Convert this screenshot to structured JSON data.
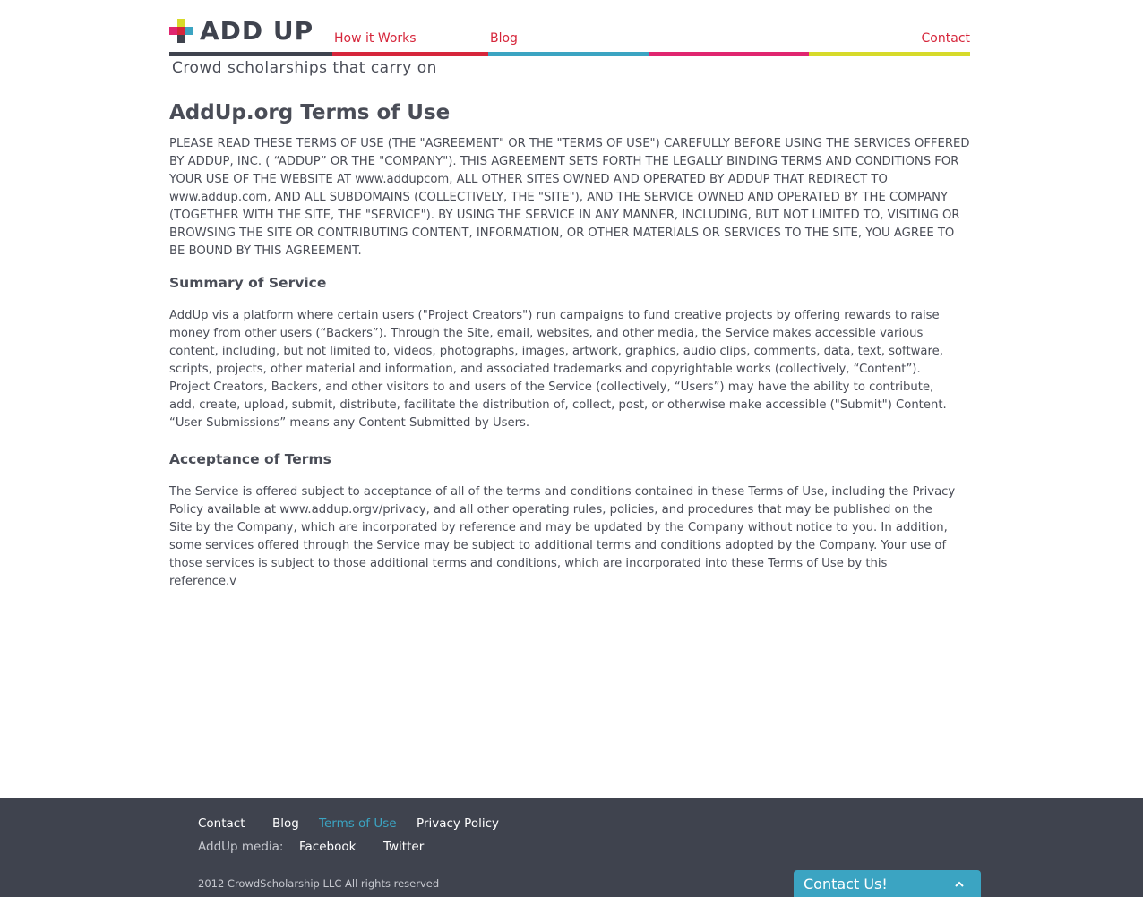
{
  "brand": {
    "logo_text": "ADD UP",
    "tagline": "Crowd scholarships that carry on",
    "colors": {
      "dark": "#3f434e",
      "red": "#d6263b",
      "blue": "#3ba4c2",
      "pink": "#e0266f",
      "yellow": "#d7da2a"
    }
  },
  "nav": {
    "how_it_works": "How it Works",
    "blog": "Blog",
    "contact": "Contact"
  },
  "page": {
    "title": "AddUp.org Terms of Use",
    "intro": "PLEASE READ THESE TERMS OF USE (THE \"AGREEMENT\" OR THE \"TERMS OF USE\") CAREFULLY BEFORE USING THE SERVICES OFFERED BY ADDUP, INC. ( “ADDUP” OR THE \"COMPANY\"). THIS AGREEMENT SETS FORTH THE LEGALLY BINDING TERMS AND CONDITIONS FOR YOUR USE OF THE WEBSITE AT www.addupcom, ALL OTHER SITES OWNED AND OPERATED BY ADDUP THAT REDIRECT TO www.addup.com, AND ALL SUBDOMAINS (COLLECTIVELY, THE \"SITE\"), AND THE SERVICE OWNED AND OPERATED BY THE COMPANY (TOGETHER WITH THE SITE, THE \"SERVICE\"). BY USING THE SERVICE IN ANY MANNER, INCLUDING, BUT NOT LIMITED TO, VISITING OR BROWSING THE SITE OR CONTRIBUTING CONTENT, INFORMATION, OR OTHER MATERIALS OR SERVICES TO THE SITE, YOU AGREE TO BE BOUND BY THIS AGREEMENT.",
    "sections": [
      {
        "title": "Summary of Service",
        "body": "AddUp vis a platform where certain users (\"Project Creators\") run campaigns to fund creative projects by offering rewards to raise money from other users (“Backers”). Through the Site, email, websites, and other media, the Service makes accessible various content, including, but not limited to, videos, photographs, images, artwork, graphics, audio clips, comments, data, text, software, scripts, projects, other material and information, and associated trademarks and copyrightable works (collectively, “Content”). Project Creators, Backers, and other visitors to and users of the Service (collectively, “Users”) may have the ability to contribute, add, create, upload, submit, distribute, facilitate the distribution of, collect, post, or otherwise make accessible (\"Submit\") Content. “User Submissions” means any Content Submitted by Users."
      },
      {
        "title": "Acceptance of Terms",
        "body": "The Service is offered subject to acceptance of all of the terms and conditions contained in these Terms of Use, including the Privacy Policy available at www.addup.orgv/privacy, and all other operating rules, policies, and procedures that may be published on the Site by the Company, which are incorporated by reference and may be updated by the Company without notice to you. In addition, some services offered through the Service may be subject to additional terms and conditions adopted by the Company. Your use of those services is subject to those additional terms and conditions, which are incorporated into these Terms of Use by this reference.v"
      }
    ]
  },
  "footer": {
    "links": {
      "contact": "Contact",
      "blog": "Blog",
      "terms": "Terms of Use",
      "privacy": "Privacy Policy"
    },
    "media_label": "AddUp media:",
    "media": {
      "facebook": "Facebook",
      "twitter": "Twitter"
    },
    "copyright": "2012 CrowdScholarship LLC All rights reserved",
    "active_link_color": "#3ba4c2"
  },
  "contact_widget": {
    "label": "Contact Us!",
    "icon": "chevron-up-icon"
  }
}
